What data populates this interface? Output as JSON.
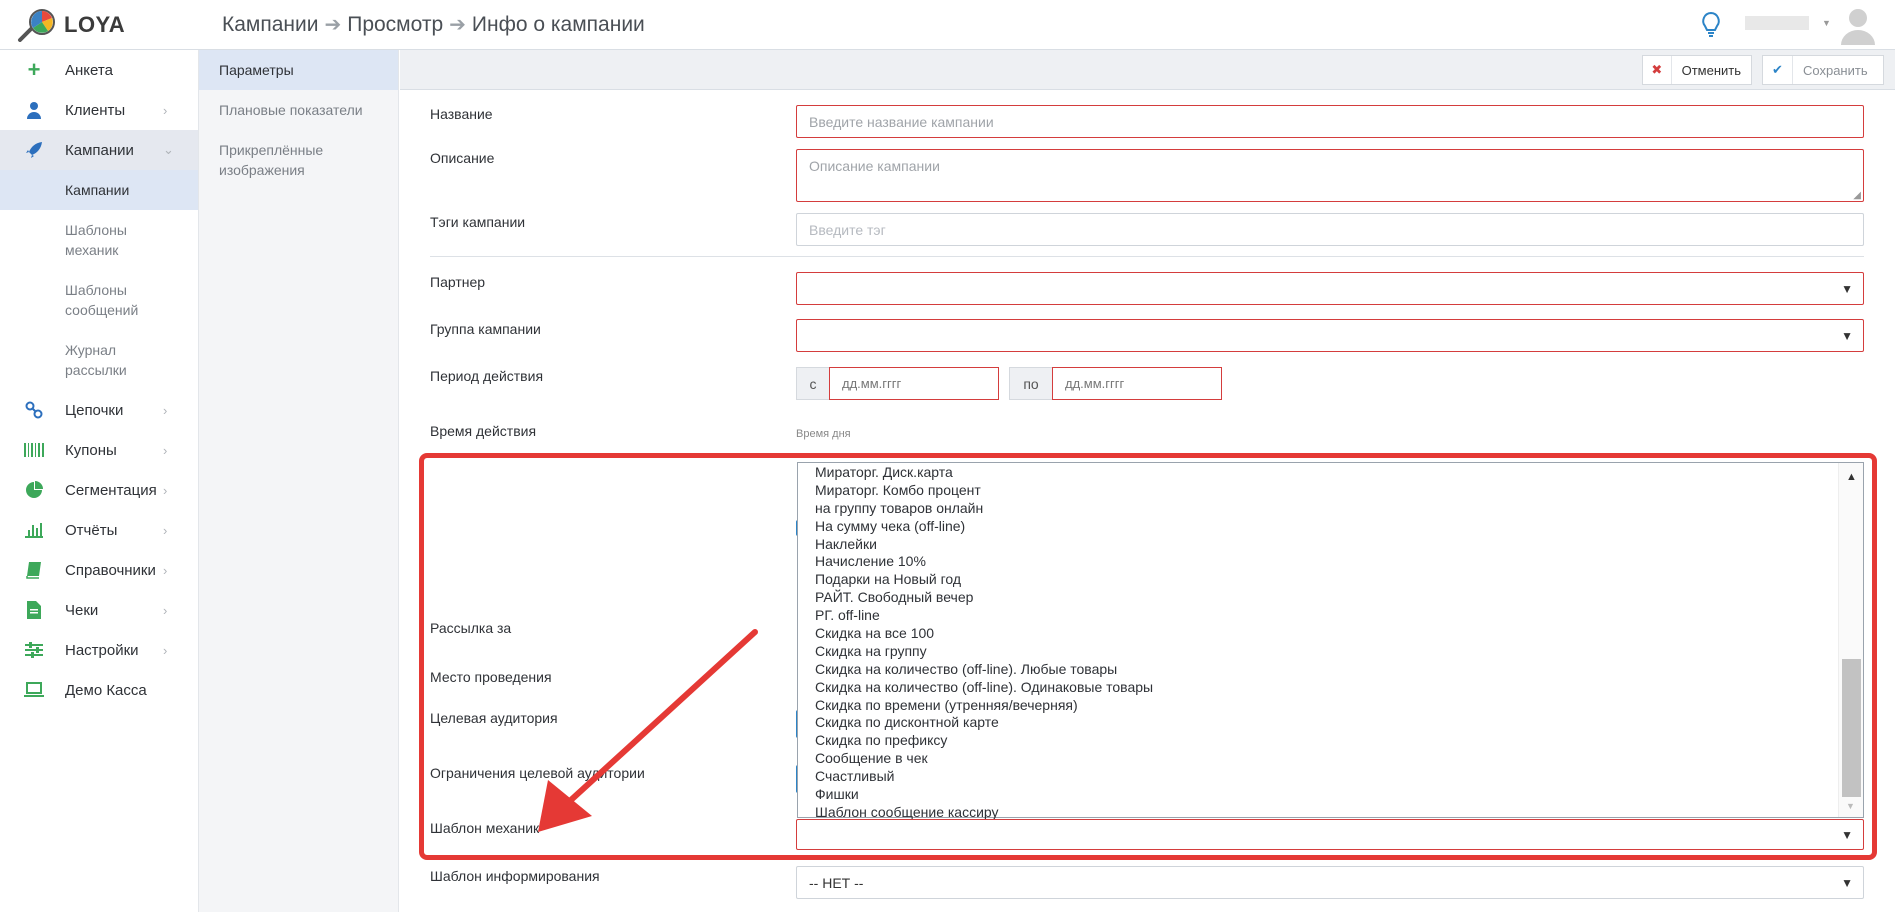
{
  "app": {
    "name": "LOYA"
  },
  "breadcrumb": [
    "Кампании",
    "Просмотр",
    "Инфо о кампании"
  ],
  "sidebar": {
    "items": [
      {
        "label": "Анкета",
        "icon": "plus-icon"
      },
      {
        "label": "Клиенты",
        "icon": "user-icon"
      },
      {
        "label": "Кампании",
        "icon": "rocket-icon"
      },
      {
        "label": "Цепочки",
        "icon": "link-icon"
      },
      {
        "label": "Купоны",
        "icon": "barcode-icon"
      },
      {
        "label": "Сегментация",
        "icon": "pie-icon"
      },
      {
        "label": "Отчёты",
        "icon": "bar-chart-icon"
      },
      {
        "label": "Справочники",
        "icon": "book-icon"
      },
      {
        "label": "Чеки",
        "icon": "file-icon"
      },
      {
        "label": "Настройки",
        "icon": "sliders-icon"
      },
      {
        "label": "Демо Касса",
        "icon": "laptop-icon"
      }
    ],
    "sub_items": [
      "Кампании",
      "Шаблоны механик",
      "Шаблоны сообщений",
      "Журнал рассылки"
    ]
  },
  "subnav": [
    "Параметры",
    "Плановые показатели",
    "Прикреплённые изображения"
  ],
  "toolbar": {
    "cancel_label": "Отменить",
    "save_label": "Сохранить"
  },
  "form": {
    "name_label": "Название",
    "name_placeholder": "Введите название кампании",
    "desc_label": "Описание",
    "desc_placeholder": "Описание кампании",
    "tags_label": "Тэги кампании",
    "tags_placeholder": "Введите тэг",
    "partner_label": "Партнер",
    "group_label": "Группа кампании",
    "period_label": "Период действия",
    "period_from": "с",
    "period_to": "по",
    "date_placeholder": "дд.мм.гггг",
    "time_label": "Время действия",
    "time_hint": "Время дня",
    "mailing_label": "Рассылка за",
    "place_label": "Место проведения",
    "audience_label": "Целевая аудитория",
    "audience_limit_label": "Ограничения целевой аудитории",
    "mechanic_label": "Шаблон механик",
    "notify_label": "Шаблон информирования",
    "notify_value": "-- НЕТ --"
  },
  "dropdown_options": [
    "Мираторг. Диск.карта",
    "Мираторг. Комбо процент",
    "на группу товаров онлайн",
    "На сумму чека (off-line)",
    "Наклейки",
    "Начисление 10%",
    "Подарки на Новый год",
    "РАЙТ. Свободный вечер",
    "РГ. off-line",
    "Скидка на все 100",
    "Скидка на группу",
    "Скидка на количество (off-line). Любые товары",
    "Скидка на количество (off-line). Одинаковые товары",
    "Скидка по времени (утренняя/вечерняя)",
    "Скидка по дисконтной карте",
    "Скидка по префиксу",
    "Сообщение в чек",
    "Счастливый",
    "Фишки",
    "Шаблон сообщение кассиру"
  ],
  "colors": {
    "accent": "#2c84c7",
    "error": "#d43d3d",
    "highlight": "#e53935"
  }
}
